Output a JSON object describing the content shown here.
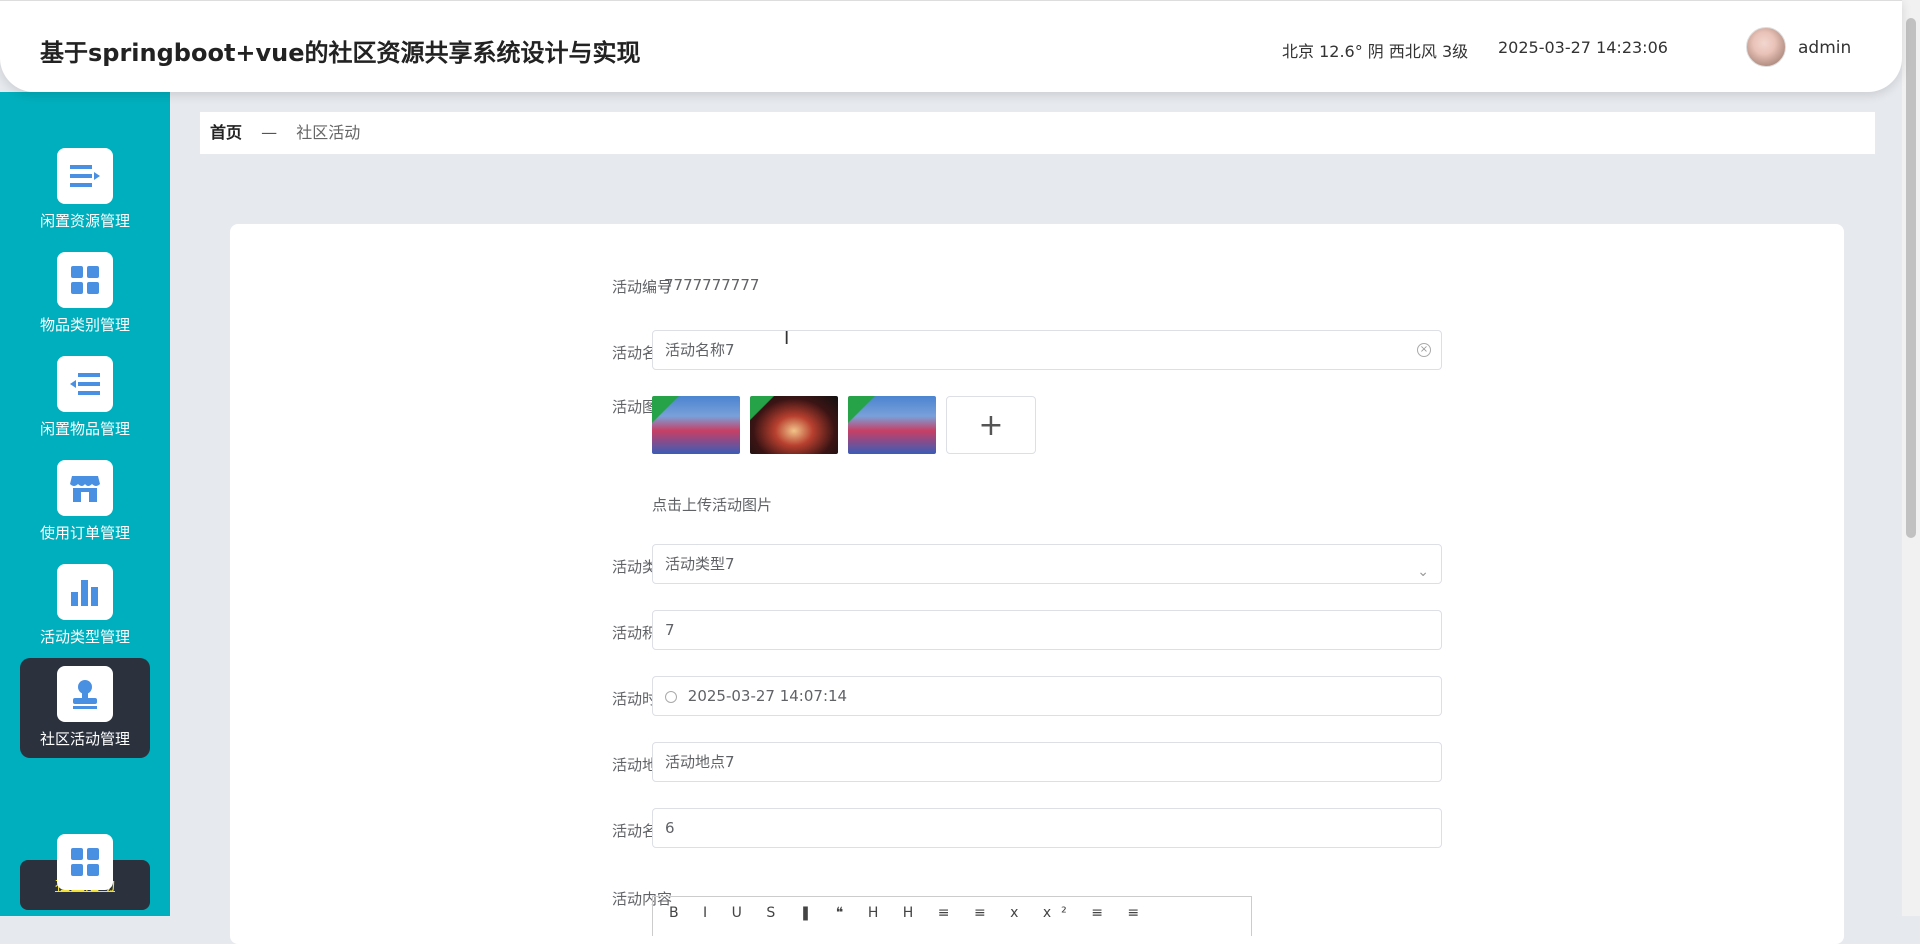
{
  "header": {
    "title": "基于springboot+vue的社区资源共享系统设计与实现",
    "weather": "北京  12.6°  阴  西北风  3级",
    "datetime": "2025-03-27 14:23:06",
    "user": "admin"
  },
  "sidebar": {
    "items": [
      {
        "label": "闲置资源管理",
        "icon": "list-icon"
      },
      {
        "label": "物品类别管理",
        "icon": "grid-icon"
      },
      {
        "label": "闲置物品管理",
        "icon": "indent-list-icon"
      },
      {
        "label": "使用订单管理",
        "icon": "store-icon"
      },
      {
        "label": "活动类型管理",
        "icon": "bar-chart-icon"
      },
      {
        "label": "社区活动管理",
        "icon": "stamp-icon"
      }
    ],
    "sub_item": "社区活动",
    "extra_icon": "grid-icon"
  },
  "breadcrumb": {
    "home": "首页",
    "separator": "—",
    "current": "社区活动"
  },
  "form": {
    "id_label": "活动编号",
    "id_value": "7777777777",
    "name_label": "活动名称",
    "name_value": "活动名称7",
    "image_label": "活动图片",
    "upload_hint": "点击上传活动图片",
    "upload_plus": "+",
    "type_label": "活动类型",
    "type_value": "活动类型7",
    "points_label": "活动积分",
    "points_value": "7",
    "time_label": "活动时间",
    "time_value": "2025-03-27 14:07:14",
    "place_label": "活动地点",
    "place_value": "活动地点7",
    "quota_label": "活动名额",
    "quota_value": "6",
    "content_label": "活动内容",
    "editor_toolbar": "B I U S ❚ ❝ H H ≡ ≡ x x² ≡ ≡"
  }
}
